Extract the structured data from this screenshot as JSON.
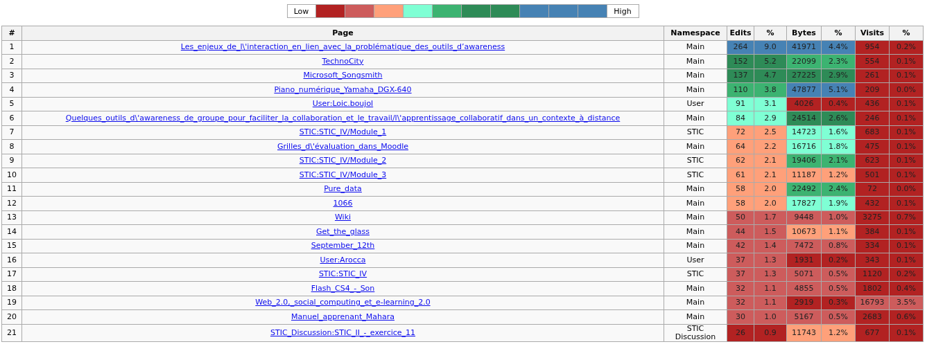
{
  "legend": {
    "low": "Low",
    "high": "High",
    "swatches": [
      {
        "color": "#b22222"
      },
      {
        "color": "#cd5c5c"
      },
      {
        "color": "#ffa07a"
      },
      {
        "color": "#7fffd4"
      },
      {
        "color": "#3cb371"
      },
      {
        "color": "#2e8b57"
      },
      {
        "color": "#2e8b57"
      },
      {
        "color": "#4682b4"
      },
      {
        "color": "#4682b4"
      },
      {
        "color": "#4682b4"
      }
    ]
  },
  "table": {
    "columns": [
      "#",
      "Page",
      "Namespace",
      "Edits",
      "%",
      "Bytes",
      "%",
      "Visits",
      "%"
    ],
    "rows": [
      {
        "num": "1",
        "page": "Les_enjeux_de_l\\'interaction_en_lien_avec_la_problématique_des_outils_d’awareness",
        "namespace": "Main",
        "edits": {
          "value": "264",
          "pct": "9.0",
          "color": "#4682b4"
        },
        "bytes": {
          "value": "41971",
          "pct": "4.4%",
          "color": "#4682b4"
        },
        "visits": {
          "value": "954",
          "pct": "0.2%",
          "color": "#b22222"
        }
      },
      {
        "num": "2",
        "page": "TechnoCity",
        "namespace": "Main",
        "edits": {
          "value": "152",
          "pct": "5.2",
          "color": "#2e8b57"
        },
        "bytes": {
          "value": "22099",
          "pct": "2.3%",
          "color": "#3cb371"
        },
        "visits": {
          "value": "554",
          "pct": "0.1%",
          "color": "#b22222"
        }
      },
      {
        "num": "3",
        "page": "Microsoft_Songsmith",
        "namespace": "Main",
        "edits": {
          "value": "137",
          "pct": "4.7",
          "color": "#2e8b57"
        },
        "bytes": {
          "value": "27225",
          "pct": "2.9%",
          "color": "#2e8b57"
        },
        "visits": {
          "value": "261",
          "pct": "0.1%",
          "color": "#b22222"
        }
      },
      {
        "num": "4",
        "page": "Piano_numérique_Yamaha_DGX-640",
        "namespace": "Main",
        "edits": {
          "value": "110",
          "pct": "3.8",
          "color": "#3cb371"
        },
        "bytes": {
          "value": "47877",
          "pct": "5.1%",
          "color": "#4682b4"
        },
        "visits": {
          "value": "209",
          "pct": "0.0%",
          "color": "#b22222"
        }
      },
      {
        "num": "5",
        "page": "User:Loic.boujol",
        "namespace": "User",
        "edits": {
          "value": "91",
          "pct": "3.1",
          "color": "#7fffd4"
        },
        "bytes": {
          "value": "4026",
          "pct": "0.4%",
          "color": "#b22222"
        },
        "visits": {
          "value": "436",
          "pct": "0.1%",
          "color": "#b22222"
        }
      },
      {
        "num": "6",
        "page": "Quelques_outils_d\\'awareness_de_groupe_pour_faciliter_la_collaboration_et_le_travail/l\\'apprentissage_collaboratif_dans_un_contexte_à_distance",
        "namespace": "Main",
        "edits": {
          "value": "84",
          "pct": "2.9",
          "color": "#7fffd4"
        },
        "bytes": {
          "value": "24514",
          "pct": "2.6%",
          "color": "#2e8b57"
        },
        "visits": {
          "value": "246",
          "pct": "0.1%",
          "color": "#b22222"
        }
      },
      {
        "num": "7",
        "page": "STIC:STIC_IV/Module_1",
        "namespace": "STIC",
        "edits": {
          "value": "72",
          "pct": "2.5",
          "color": "#ffa07a"
        },
        "bytes": {
          "value": "14723",
          "pct": "1.6%",
          "color": "#7fffd4"
        },
        "visits": {
          "value": "683",
          "pct": "0.1%",
          "color": "#b22222"
        }
      },
      {
        "num": "8",
        "page": "Grilles_d\\'évaluation_dans_Moodle",
        "namespace": "Main",
        "edits": {
          "value": "64",
          "pct": "2.2",
          "color": "#ffa07a"
        },
        "bytes": {
          "value": "16716",
          "pct": "1.8%",
          "color": "#7fffd4"
        },
        "visits": {
          "value": "475",
          "pct": "0.1%",
          "color": "#b22222"
        }
      },
      {
        "num": "9",
        "page": "STIC:STIC_IV/Module_2",
        "namespace": "STIC",
        "edits": {
          "value": "62",
          "pct": "2.1",
          "color": "#ffa07a"
        },
        "bytes": {
          "value": "19406",
          "pct": "2.1%",
          "color": "#3cb371"
        },
        "visits": {
          "value": "623",
          "pct": "0.1%",
          "color": "#b22222"
        }
      },
      {
        "num": "10",
        "page": "STIC:STIC_IV/Module_3",
        "namespace": "STIC",
        "edits": {
          "value": "61",
          "pct": "2.1",
          "color": "#ffa07a"
        },
        "bytes": {
          "value": "11187",
          "pct": "1.2%",
          "color": "#ffa07a"
        },
        "visits": {
          "value": "501",
          "pct": "0.1%",
          "color": "#b22222"
        }
      },
      {
        "num": "11",
        "page": "Pure_data",
        "namespace": "Main",
        "edits": {
          "value": "58",
          "pct": "2.0",
          "color": "#ffa07a"
        },
        "bytes": {
          "value": "22492",
          "pct": "2.4%",
          "color": "#3cb371"
        },
        "visits": {
          "value": "72",
          "pct": "0.0%",
          "color": "#b22222"
        }
      },
      {
        "num": "12",
        "page": "1066",
        "namespace": "Main",
        "edits": {
          "value": "58",
          "pct": "2.0",
          "color": "#ffa07a"
        },
        "bytes": {
          "value": "17827",
          "pct": "1.9%",
          "color": "#7fffd4"
        },
        "visits": {
          "value": "432",
          "pct": "0.1%",
          "color": "#b22222"
        }
      },
      {
        "num": "13",
        "page": "Wiki",
        "namespace": "Main",
        "edits": {
          "value": "50",
          "pct": "1.7",
          "color": "#cd5c5c"
        },
        "bytes": {
          "value": "9448",
          "pct": "1.0%",
          "color": "#cd5c5c"
        },
        "visits": {
          "value": "3275",
          "pct": "0.7%",
          "color": "#b22222"
        }
      },
      {
        "num": "14",
        "page": "Get_the_glass",
        "namespace": "Main",
        "edits": {
          "value": "44",
          "pct": "1.5",
          "color": "#cd5c5c"
        },
        "bytes": {
          "value": "10673",
          "pct": "1.1%",
          "color": "#ffa07a"
        },
        "visits": {
          "value": "384",
          "pct": "0.1%",
          "color": "#b22222"
        }
      },
      {
        "num": "15",
        "page": "September_12th",
        "namespace": "Main",
        "edits": {
          "value": "42",
          "pct": "1.4",
          "color": "#cd5c5c"
        },
        "bytes": {
          "value": "7472",
          "pct": "0.8%",
          "color": "#cd5c5c"
        },
        "visits": {
          "value": "334",
          "pct": "0.1%",
          "color": "#b22222"
        }
      },
      {
        "num": "16",
        "page": "User:Arocca",
        "namespace": "User",
        "edits": {
          "value": "37",
          "pct": "1.3",
          "color": "#cd5c5c"
        },
        "bytes": {
          "value": "1931",
          "pct": "0.2%",
          "color": "#b22222"
        },
        "visits": {
          "value": "343",
          "pct": "0.1%",
          "color": "#b22222"
        }
      },
      {
        "num": "17",
        "page": "STIC:STIC_IV",
        "namespace": "STIC",
        "edits": {
          "value": "37",
          "pct": "1.3",
          "color": "#cd5c5c"
        },
        "bytes": {
          "value": "5071",
          "pct": "0.5%",
          "color": "#cd5c5c"
        },
        "visits": {
          "value": "1120",
          "pct": "0.2%",
          "color": "#b22222"
        }
      },
      {
        "num": "18",
        "page": "Flash_CS4_-_Son",
        "namespace": "Main",
        "edits": {
          "value": "32",
          "pct": "1.1",
          "color": "#cd5c5c"
        },
        "bytes": {
          "value": "4855",
          "pct": "0.5%",
          "color": "#cd5c5c"
        },
        "visits": {
          "value": "1802",
          "pct": "0.4%",
          "color": "#b22222"
        }
      },
      {
        "num": "19",
        "page": "Web_2.0,_social_computing_et_e-learning_2.0",
        "namespace": "Main",
        "edits": {
          "value": "32",
          "pct": "1.1",
          "color": "#cd5c5c"
        },
        "bytes": {
          "value": "2919",
          "pct": "0.3%",
          "color": "#b22222"
        },
        "visits": {
          "value": "16793",
          "pct": "3.5%",
          "color": "#cd5c5c"
        }
      },
      {
        "num": "20",
        "page": "Manuel_apprenant_Mahara",
        "namespace": "Main",
        "edits": {
          "value": "30",
          "pct": "1.0",
          "color": "#cd5c5c"
        },
        "bytes": {
          "value": "5167",
          "pct": "0.5%",
          "color": "#cd5c5c"
        },
        "visits": {
          "value": "2683",
          "pct": "0.6%",
          "color": "#b22222"
        }
      },
      {
        "num": "21",
        "page": "STIC_Discussion:STIC_II_-_exercice_11",
        "namespace": "STIC Discussion",
        "edits": {
          "value": "26",
          "pct": "0.9",
          "color": "#b22222"
        },
        "bytes": {
          "value": "11743",
          "pct": "1.2%",
          "color": "#ffa07a"
        },
        "visits": {
          "value": "677",
          "pct": "0.1%",
          "color": "#b22222"
        }
      }
    ]
  }
}
